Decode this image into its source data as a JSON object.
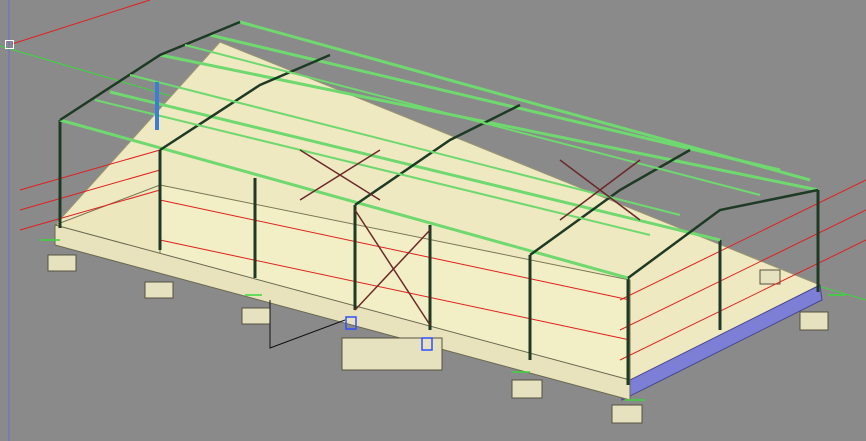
{
  "viewport": {
    "view_type": "isometric-3d-model",
    "background_color": "#8a8a8a"
  },
  "colors": {
    "steel_frame": "#1e3a24",
    "purlin_green": "#6fd86f",
    "wall_panel": "#f2eec5",
    "floor_slab": "#efe9c2",
    "foundation": "#e6e2bf",
    "base_band": "#7d7fd6",
    "red_axis": "#e02020",
    "green_axis": "#3bd83b",
    "blue_axis": "#6a6ae8",
    "highlight_column": "#3a7fd5",
    "support_symbol": "#3050ff"
  },
  "icons": {
    "origin_handle": "square-handle-icon",
    "support": "pin-support-icon"
  }
}
